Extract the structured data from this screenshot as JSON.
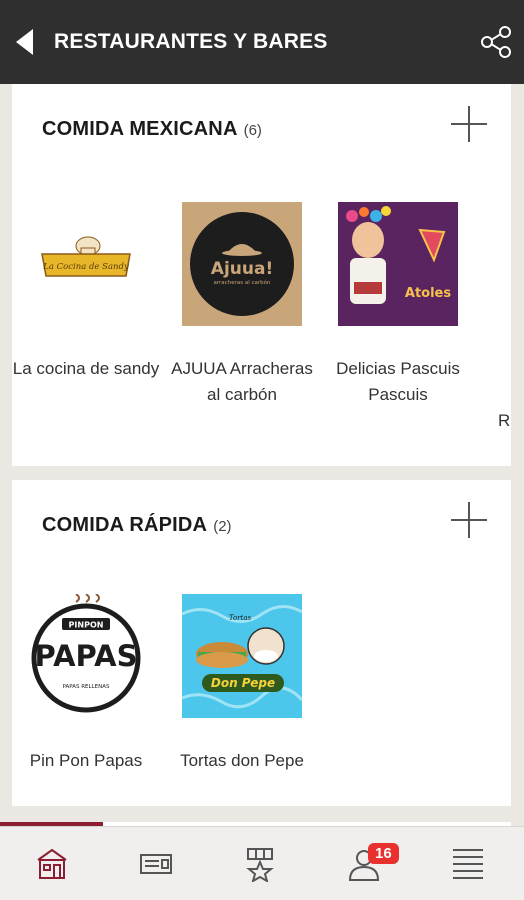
{
  "header": {
    "title": "RESTAURANTES Y BARES",
    "back_icon": "back-arrow-icon",
    "share_icon": "share-icon"
  },
  "categories": [
    {
      "title": "COMIDA MEXICANA",
      "count": "(6)",
      "items": [
        {
          "name": "La cocina de sandy",
          "logo_text": "La Cocina de Sandy"
        },
        {
          "name": "AJUUA Arracheras al carbón",
          "logo_text": "Ajuua!",
          "logo_subtext": "arracheras al carbón"
        },
        {
          "name": "Delicias Pascuis Pascuis",
          "logo_text": "Atoles"
        },
        {
          "name": "Res"
        }
      ]
    },
    {
      "title": "COMIDA RÁPIDA",
      "count": "(2)",
      "items": [
        {
          "name": "Pin Pon Papas",
          "logo_text_top": "PINPON",
          "logo_text_main": "PAPAS",
          "logo_text_bottom": "PAPAS RELLENAS"
        },
        {
          "name": "Tortas don Pepe",
          "logo_text_top": "Tortas",
          "logo_text_main": "Don Pepe"
        }
      ]
    }
  ],
  "bottom_nav": {
    "tabs": [
      {
        "icon": "storefront-icon"
      },
      {
        "icon": "ticket-icon"
      },
      {
        "icon": "award-star-icon"
      },
      {
        "icon": "user-icon",
        "badge": "16"
      },
      {
        "icon": "menu-lines-icon"
      }
    ]
  },
  "colors": {
    "header_bg": "#2f2f2f",
    "accent": "#8b1e32",
    "badge": "#e8312f",
    "page_bg": "#ebe8e4"
  }
}
